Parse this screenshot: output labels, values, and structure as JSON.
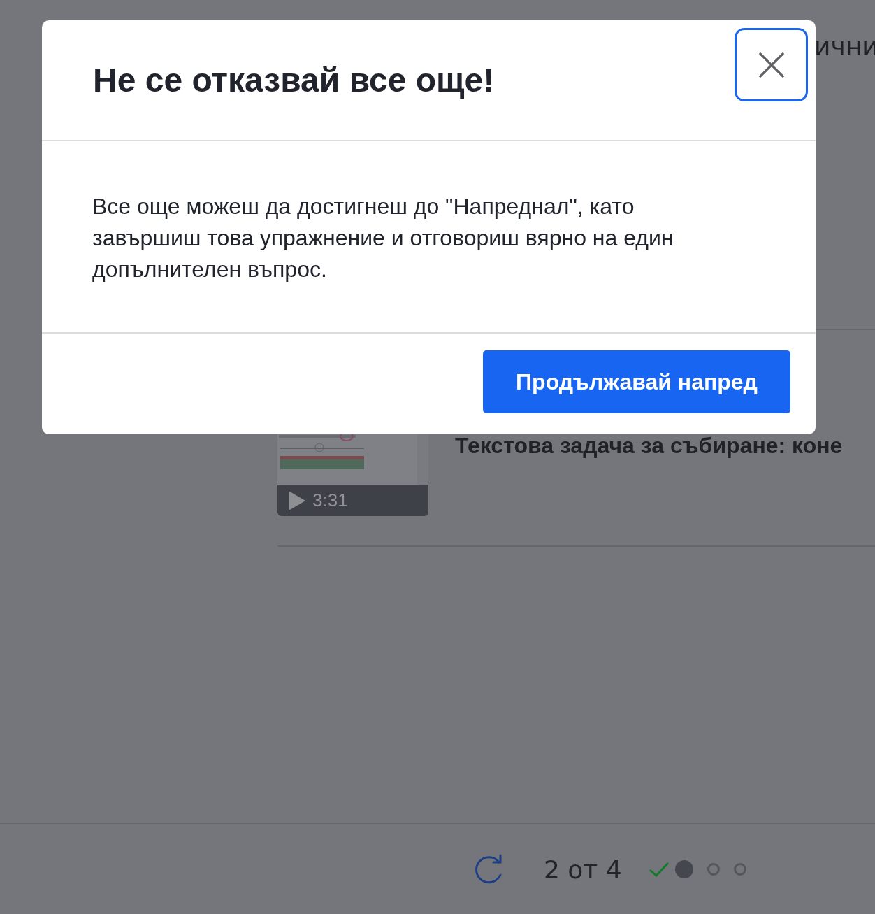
{
  "page": {
    "heading_fragment": "ични",
    "video": {
      "kind": "picture",
      "duration": "3:31",
      "title": "Текстова задача за събиране: коне"
    }
  },
  "footer": {
    "counter": "2 от 4",
    "progress": [
      {
        "kind": "done"
      },
      {
        "kind": "current"
      },
      {
        "kind": "pending"
      },
      {
        "kind": "pending"
      }
    ]
  },
  "modal": {
    "title": "Не се отказвай все още!",
    "body": "Все още можеш да достигнеш до \"Напреднал\", като завършиш това упражнение и отговориш вярно на един допълнителен въпрос.",
    "button": "Продължавай напред"
  }
}
